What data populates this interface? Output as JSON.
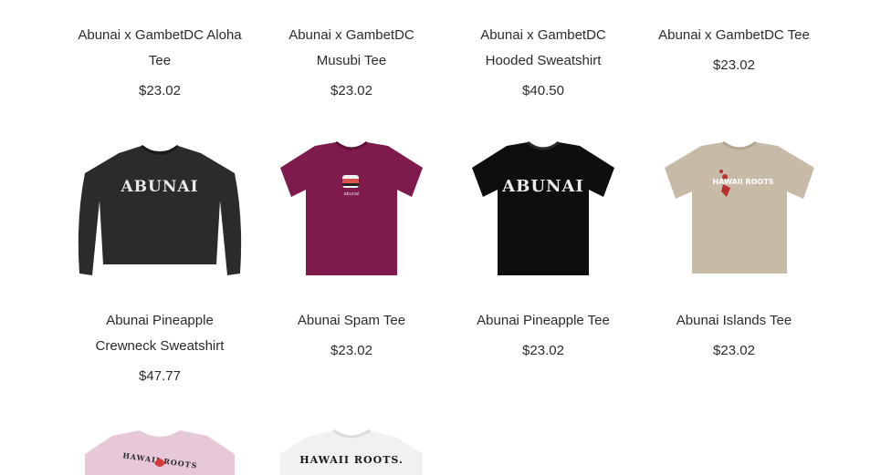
{
  "products": [
    {
      "name": "Abunai x GambetDC Aloha Tee",
      "price": "$23.02"
    },
    {
      "name": "Abunai x GambetDC Musubi Tee",
      "price": "$23.02"
    },
    {
      "name": "Abunai x GambetDC Hooded Sweatshirt",
      "price": "$40.50"
    },
    {
      "name": "Abunai x GambetDC Tee",
      "price": "$23.02"
    },
    {
      "name": "Abunai Pineapple Crewneck Sweatshirt",
      "price": "$47.77",
      "graphic": "ABUNAI",
      "color": "#2b2b2b"
    },
    {
      "name": "Abunai Spam Tee",
      "price": "$23.02",
      "graphic": "abunai",
      "color": "#7e1b4c"
    },
    {
      "name": "Abunai Pineapple Tee",
      "price": "$23.02",
      "graphic": "ABUNAI",
      "color": "#0e0e0e"
    },
    {
      "name": "Abunai Islands Tee",
      "price": "$23.02",
      "graphic": "HAWAII ROOTS",
      "color": "#c7bba8"
    },
    {
      "graphic": "HAWAII ROOTS",
      "color": "#e6c8d8"
    },
    {
      "graphic": "HAWAII ROOTS.",
      "color": "#f1f1f1"
    }
  ]
}
